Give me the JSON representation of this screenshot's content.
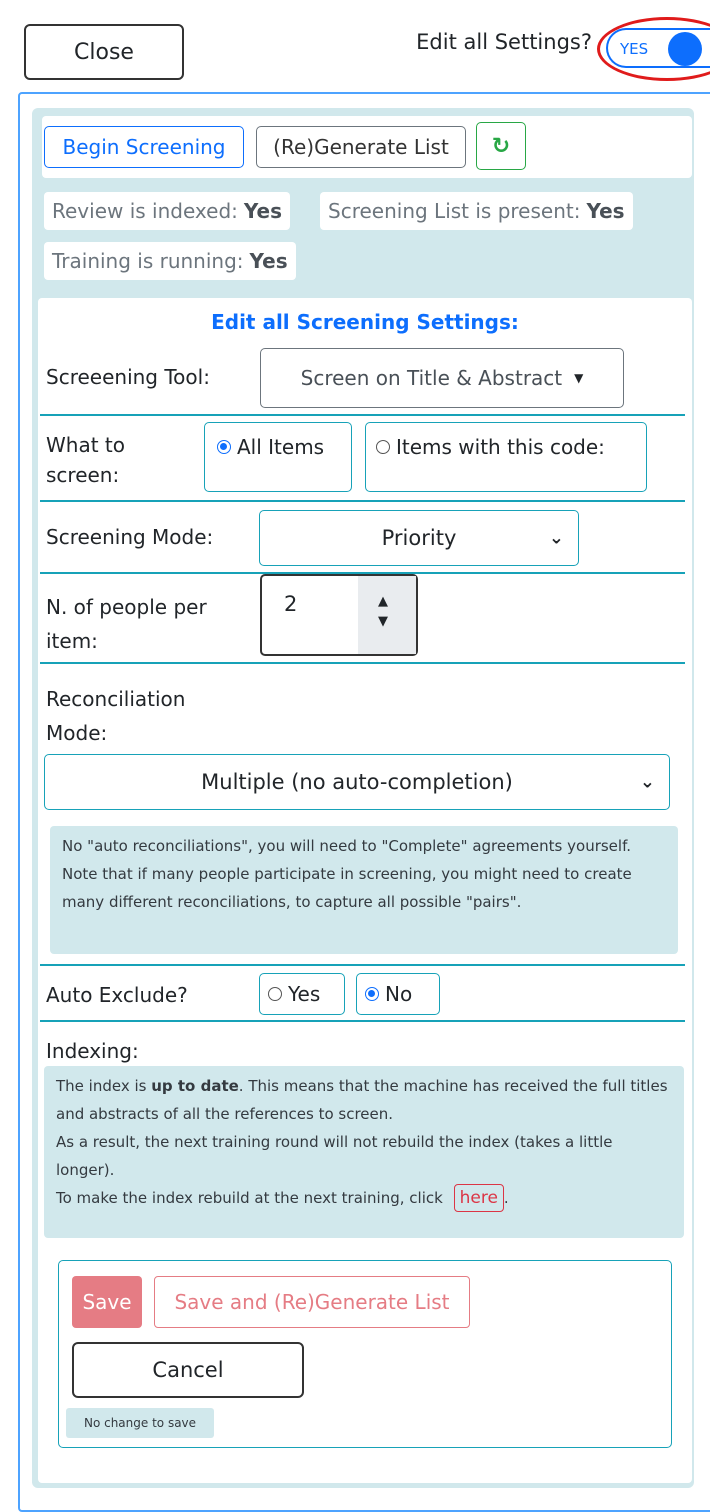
{
  "header": {
    "close_label": "Close",
    "edit_all_label": "Edit all Settings?",
    "toggle_label": "YES",
    "toggle_on": true
  },
  "actions": {
    "begin_label": "Begin Screening",
    "regen_label": "(Re)Generate List",
    "refresh_icon": "refresh-icon"
  },
  "status": [
    {
      "label": "Review is indexed:",
      "value": "Yes"
    },
    {
      "label": "Screening List is present:",
      "value": "Yes"
    },
    {
      "label": "Training is running:",
      "value": "Yes"
    }
  ],
  "settings": {
    "heading": "Edit all Screening Settings:",
    "tool_label": "Screeening Tool:",
    "tool_value": "Screen on Title & Abstract",
    "what_label_1": "What to",
    "what_label_2": "screen:",
    "what_option_all": "All Items",
    "what_option_code": "Items with this code:",
    "what_selected": "all",
    "mode_label": "Screening Mode:",
    "mode_value": "Priority",
    "people_label_1": "N. of people per",
    "people_label_2": "item:",
    "people_value": "2",
    "recon_label_1": "Reconciliation",
    "recon_label_2": "Mode:",
    "recon_value": "Multiple (no auto-completion)",
    "recon_note": "No \"auto reconciliations\", you will need to \"Complete\" agreements yourself. Note that if many people participate in screening, you might need to create many different reconciliations, to capture all possible \"pairs\".",
    "auto_exclude_label": "Auto Exclude?",
    "auto_yes": "Yes",
    "auto_no": "No",
    "auto_selected": "no",
    "indexing_label": "Indexing:",
    "index_p1_pre": "The index is",
    "index_p1_bold": "up to date",
    "index_p1_post": ". This means that the machine has received the full titles and abstracts of all the references to screen.",
    "index_p2": "As a result, the next training round will not rebuild the index (takes a little longer).",
    "index_p3": "To make the index rebuild at the next training, click",
    "here_label": "here",
    "index_p3_end": "."
  },
  "footer": {
    "save_label": "Save",
    "save_regen_label": "Save and (Re)Generate List",
    "cancel_label": "Cancel",
    "nochange_label": "No change to save"
  }
}
